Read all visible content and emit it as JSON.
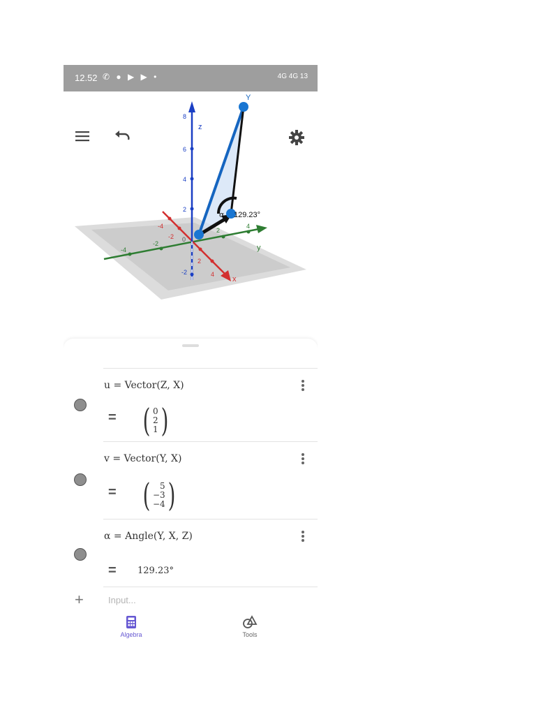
{
  "status_bar": {
    "time": "12.52",
    "left_icons": [
      "whatsapp-icon",
      "chat-icon",
      "youtube-icon",
      "youtube-icon",
      "dot"
    ],
    "right_text": "4G 4G 13"
  },
  "graphics_view": {
    "z_axis_label": "z",
    "y_axis_label": "y",
    "x_axis_label": "x",
    "origin_label": "0",
    "z_ticks": [
      "8",
      "6",
      "4",
      "2",
      "-2"
    ],
    "y_ticks": [
      "-4",
      "-2",
      "2",
      "4"
    ],
    "x_ticks": [
      "-4",
      "-2",
      "2",
      "4"
    ],
    "point_label": "Y",
    "angle_name": "α",
    "angle_label": "129.23°",
    "colors": {
      "x_axis": "#d32f2f",
      "y_axis": "#2e7d32",
      "z_axis": "#1a3fc4",
      "vector_blue": "#1565c0",
      "angle_black": "#111111"
    }
  },
  "toolbar": {
    "menu_icon": "hamburger-menu-icon",
    "undo_icon": "undo-icon",
    "settings_icon": "gear-icon"
  },
  "algebra": {
    "rows": [
      {
        "definition": "u = Vector(Z, X)",
        "equals": "=",
        "components": [
          "0",
          "2",
          "1"
        ]
      },
      {
        "definition": "v = Vector(Y, X)",
        "equals": "=",
        "components": [
          "5",
          "−3",
          "−4"
        ]
      },
      {
        "definition": "α = Angle(Y, X, Z)",
        "equals": "=",
        "value": "129.23°"
      }
    ],
    "input_placeholder": "Input...",
    "add_symbol": "+"
  },
  "bottom_nav": {
    "algebra_label": "Algebra",
    "tools_label": "Tools",
    "active_color": "#6557d2"
  }
}
